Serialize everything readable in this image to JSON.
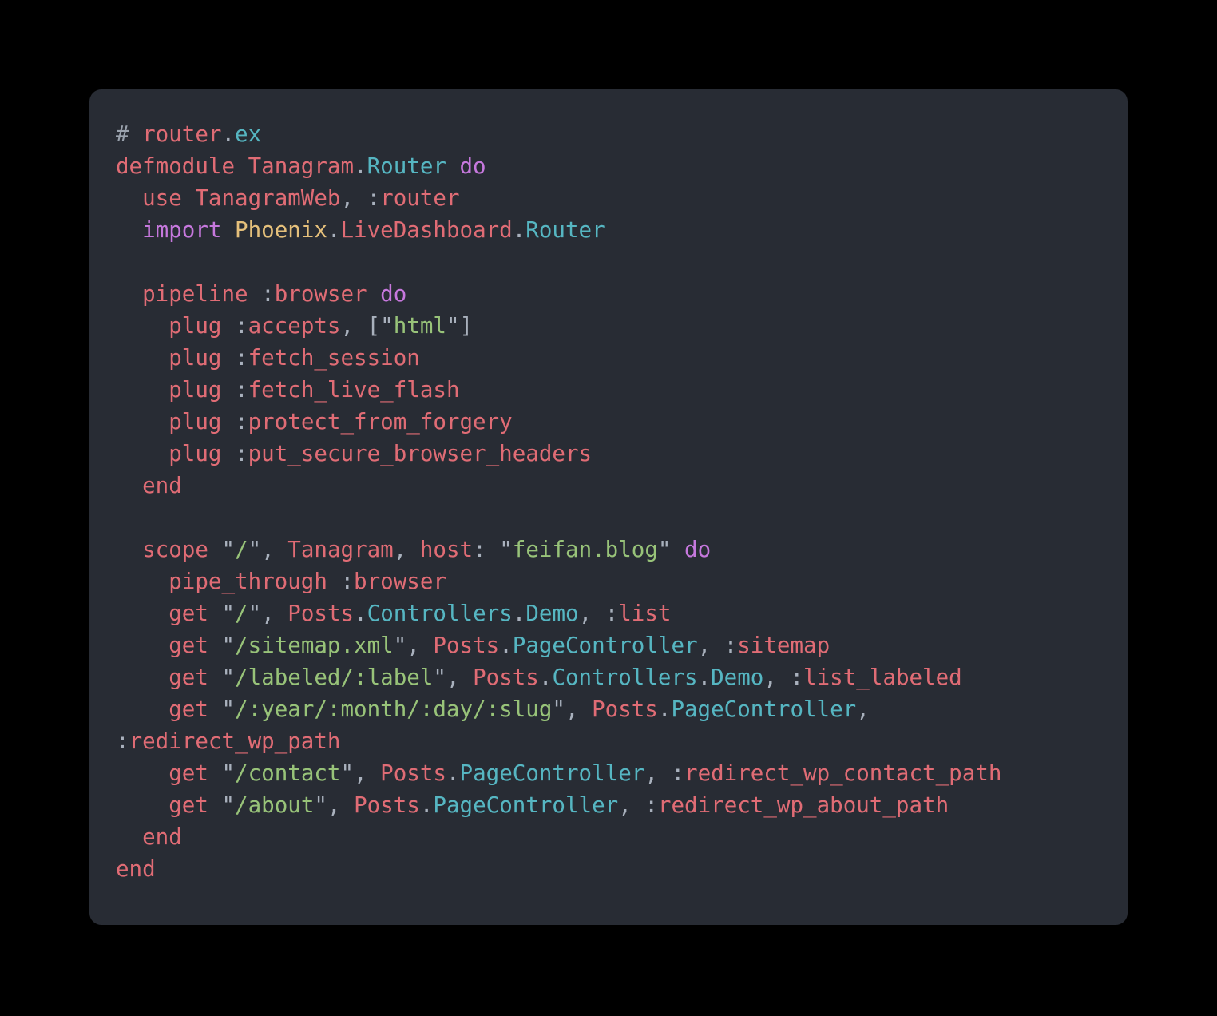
{
  "card": {
    "language": "elixir",
    "filename": "router.ex",
    "background": "#282c34",
    "page_background": "#000000"
  },
  "theme": {
    "name": "one-dark",
    "foreground": "#abb2bf",
    "punctuation": "#a9b1bd",
    "keyword": "#e06c75",
    "keyword_do": "#c678dd",
    "atom": "#e06c75",
    "module": "#56b6c2",
    "module_alt_red": "#e06c75",
    "module_alt_yellow": "#e5c07b",
    "string": "#98c379",
    "comment": "#9aa2ad"
  },
  "code": {
    "raw": "# router.ex\ndefmodule Tanagram.Router do\n  use TanagramWeb, :router\n  import Phoenix.LiveDashboard.Router\n\n  pipeline :browser do\n    plug :accepts, [\"html\"]\n    plug :fetch_session\n    plug :fetch_live_flash\n    plug :protect_from_forgery\n    plug :put_secure_browser_headers\n  end\n\n  scope \"/\", Tanagram, host: \"feifan.blog\" do\n    pipe_through :browser\n    get \"/\", Posts.Controllers.Demo, :list\n    get \"/sitemap.xml\", Posts.PageController, :sitemap\n    get \"/labeled/:label\", Posts.Controllers.Demo, :list_labeled\n    get \"/:year/:month/:day/:slug\", Posts.PageController, :redirect_wp_path\n    get \"/contact\", Posts.PageController, :redirect_wp_contact_path\n    get \"/about\", Posts.PageController, :redirect_wp_about_path\n  end\nend",
    "lines": [
      {
        "n": 1,
        "text": "# router.ex",
        "tokens": [
          {
            "t": "# ",
            "c": "com"
          },
          {
            "t": "router",
            "c": "kw"
          },
          {
            "t": ".",
            "c": "punc"
          },
          {
            "t": "ex",
            "c": "mod"
          }
        ]
      },
      {
        "n": 2,
        "text": "defmodule Tanagram.Router do",
        "tokens": [
          {
            "t": "defmodule ",
            "c": "kw"
          },
          {
            "t": "Tanagram",
            "c": "modred"
          },
          {
            "t": ".",
            "c": "punc"
          },
          {
            "t": "Router",
            "c": "mod"
          },
          {
            "t": " ",
            "c": "punc"
          },
          {
            "t": "do",
            "c": "kwdo"
          }
        ]
      },
      {
        "n": 3,
        "text": "  use TanagramWeb, :router",
        "tokens": [
          {
            "t": "  ",
            "c": "punc"
          },
          {
            "t": "use ",
            "c": "kw"
          },
          {
            "t": "TanagramWeb",
            "c": "modred"
          },
          {
            "t": ", ",
            "c": "punc"
          },
          {
            "t": ":",
            "c": "punc"
          },
          {
            "t": "router",
            "c": "atom"
          }
        ]
      },
      {
        "n": 4,
        "text": "  import Phoenix.LiveDashboard.Router",
        "tokens": [
          {
            "t": "  ",
            "c": "punc"
          },
          {
            "t": "import ",
            "c": "kwdo"
          },
          {
            "t": "Phoenix",
            "c": "modyel"
          },
          {
            "t": ".",
            "c": "punc"
          },
          {
            "t": "LiveDashboard",
            "c": "modred"
          },
          {
            "t": ".",
            "c": "punc"
          },
          {
            "t": "Router",
            "c": "mod"
          }
        ]
      },
      {
        "n": 5,
        "text": "",
        "tokens": []
      },
      {
        "n": 6,
        "text": "  pipeline :browser do",
        "tokens": [
          {
            "t": "  ",
            "c": "punc"
          },
          {
            "t": "pipeline ",
            "c": "kw"
          },
          {
            "t": ":",
            "c": "punc"
          },
          {
            "t": "browser",
            "c": "atom"
          },
          {
            "t": " ",
            "c": "punc"
          },
          {
            "t": "do",
            "c": "kwdo"
          }
        ]
      },
      {
        "n": 7,
        "text": "    plug :accepts, [\"html\"]",
        "tokens": [
          {
            "t": "    ",
            "c": "punc"
          },
          {
            "t": "plug ",
            "c": "kw"
          },
          {
            "t": ":",
            "c": "punc"
          },
          {
            "t": "accepts",
            "c": "atom"
          },
          {
            "t": ", [",
            "c": "punc"
          },
          {
            "t": "\"",
            "c": "quote"
          },
          {
            "t": "html",
            "c": "str"
          },
          {
            "t": "\"",
            "c": "quote"
          },
          {
            "t": "]",
            "c": "punc"
          }
        ]
      },
      {
        "n": 8,
        "text": "    plug :fetch_session",
        "tokens": [
          {
            "t": "    ",
            "c": "punc"
          },
          {
            "t": "plug ",
            "c": "kw"
          },
          {
            "t": ":",
            "c": "punc"
          },
          {
            "t": "fetch_session",
            "c": "atom"
          }
        ]
      },
      {
        "n": 9,
        "text": "    plug :fetch_live_flash",
        "tokens": [
          {
            "t": "    ",
            "c": "punc"
          },
          {
            "t": "plug ",
            "c": "kw"
          },
          {
            "t": ":",
            "c": "punc"
          },
          {
            "t": "fetch_live_flash",
            "c": "atom"
          }
        ]
      },
      {
        "n": 10,
        "text": "    plug :protect_from_forgery",
        "tokens": [
          {
            "t": "    ",
            "c": "punc"
          },
          {
            "t": "plug ",
            "c": "kw"
          },
          {
            "t": ":",
            "c": "punc"
          },
          {
            "t": "protect_from_forgery",
            "c": "atom"
          }
        ]
      },
      {
        "n": 11,
        "text": "    plug :put_secure_browser_headers",
        "tokens": [
          {
            "t": "    ",
            "c": "punc"
          },
          {
            "t": "plug ",
            "c": "kw"
          },
          {
            "t": ":",
            "c": "punc"
          },
          {
            "t": "put_secure_browser_headers",
            "c": "atom"
          }
        ]
      },
      {
        "n": 12,
        "text": "  end",
        "tokens": [
          {
            "t": "  ",
            "c": "punc"
          },
          {
            "t": "end",
            "c": "kw"
          }
        ]
      },
      {
        "n": 13,
        "text": "",
        "tokens": []
      },
      {
        "n": 14,
        "text": "  scope \"/\", Tanagram, host: \"feifan.blog\" do",
        "tokens": [
          {
            "t": "  ",
            "c": "punc"
          },
          {
            "t": "scope ",
            "c": "kw"
          },
          {
            "t": "\"",
            "c": "quote"
          },
          {
            "t": "/",
            "c": "str"
          },
          {
            "t": "\"",
            "c": "quote"
          },
          {
            "t": ", ",
            "c": "punc"
          },
          {
            "t": "Tanagram",
            "c": "modred"
          },
          {
            "t": ", ",
            "c": "punc"
          },
          {
            "t": "host",
            "c": "kw"
          },
          {
            "t": ": ",
            "c": "punc"
          },
          {
            "t": "\"",
            "c": "quote"
          },
          {
            "t": "feifan.blog",
            "c": "str"
          },
          {
            "t": "\"",
            "c": "quote"
          },
          {
            "t": " ",
            "c": "punc"
          },
          {
            "t": "do",
            "c": "kwdo"
          }
        ]
      },
      {
        "n": 15,
        "text": "    pipe_through :browser",
        "tokens": [
          {
            "t": "    ",
            "c": "punc"
          },
          {
            "t": "pipe_through ",
            "c": "kw"
          },
          {
            "t": ":",
            "c": "punc"
          },
          {
            "t": "browser",
            "c": "atom"
          }
        ]
      },
      {
        "n": 16,
        "text": "    get \"/\", Posts.Controllers.Demo, :list",
        "tokens": [
          {
            "t": "    ",
            "c": "punc"
          },
          {
            "t": "get ",
            "c": "kw"
          },
          {
            "t": "\"",
            "c": "quote"
          },
          {
            "t": "/",
            "c": "str"
          },
          {
            "t": "\"",
            "c": "quote"
          },
          {
            "t": ", ",
            "c": "punc"
          },
          {
            "t": "Posts",
            "c": "modred"
          },
          {
            "t": ".",
            "c": "punc"
          },
          {
            "t": "Controllers",
            "c": "mod"
          },
          {
            "t": ".",
            "c": "punc"
          },
          {
            "t": "Demo",
            "c": "mod"
          },
          {
            "t": ", ",
            "c": "punc"
          },
          {
            "t": ":",
            "c": "punc"
          },
          {
            "t": "list",
            "c": "atom"
          }
        ]
      },
      {
        "n": 17,
        "text": "    get \"/sitemap.xml\", Posts.PageController, :sitemap",
        "tokens": [
          {
            "t": "    ",
            "c": "punc"
          },
          {
            "t": "get ",
            "c": "kw"
          },
          {
            "t": "\"",
            "c": "quote"
          },
          {
            "t": "/sitemap.xml",
            "c": "str"
          },
          {
            "t": "\"",
            "c": "quote"
          },
          {
            "t": ", ",
            "c": "punc"
          },
          {
            "t": "Posts",
            "c": "modred"
          },
          {
            "t": ".",
            "c": "punc"
          },
          {
            "t": "PageController",
            "c": "mod"
          },
          {
            "t": ", ",
            "c": "punc"
          },
          {
            "t": ":",
            "c": "punc"
          },
          {
            "t": "sitemap",
            "c": "atom"
          }
        ]
      },
      {
        "n": 18,
        "text": "    get \"/labeled/:label\", Posts.Controllers.Demo, :list_labeled",
        "tokens": [
          {
            "t": "    ",
            "c": "punc"
          },
          {
            "t": "get ",
            "c": "kw"
          },
          {
            "t": "\"",
            "c": "quote"
          },
          {
            "t": "/labeled/:label",
            "c": "str"
          },
          {
            "t": "\"",
            "c": "quote"
          },
          {
            "t": ", ",
            "c": "punc"
          },
          {
            "t": "Posts",
            "c": "modred"
          },
          {
            "t": ".",
            "c": "punc"
          },
          {
            "t": "Controllers",
            "c": "mod"
          },
          {
            "t": ".",
            "c": "punc"
          },
          {
            "t": "Demo",
            "c": "mod"
          },
          {
            "t": ", ",
            "c": "punc"
          },
          {
            "t": ":",
            "c": "punc"
          },
          {
            "t": "list_labeled",
            "c": "atom"
          }
        ]
      },
      {
        "n": 19,
        "text": "    get \"/:year/:month/:day/:slug\", Posts.PageController, :redirect_wp_path",
        "wrapped": true,
        "tokens": [
          {
            "t": "    ",
            "c": "punc"
          },
          {
            "t": "get ",
            "c": "kw"
          },
          {
            "t": "\"",
            "c": "quote"
          },
          {
            "t": "/:year/:month/:day/:slug",
            "c": "str"
          },
          {
            "t": "\"",
            "c": "quote"
          },
          {
            "t": ", ",
            "c": "punc"
          },
          {
            "t": "Posts",
            "c": "modred"
          },
          {
            "t": ".",
            "c": "punc"
          },
          {
            "t": "PageController",
            "c": "mod"
          },
          {
            "t": ", ",
            "c": "punc"
          },
          {
            "t": ":",
            "c": "punc"
          },
          {
            "t": "redirect_wp_path",
            "c": "atom"
          }
        ]
      },
      {
        "n": 20,
        "text": "    get \"/contact\", Posts.PageController, :redirect_wp_contact_path",
        "tokens": [
          {
            "t": "    ",
            "c": "punc"
          },
          {
            "t": "get ",
            "c": "kw"
          },
          {
            "t": "\"",
            "c": "quote"
          },
          {
            "t": "/contact",
            "c": "str"
          },
          {
            "t": "\"",
            "c": "quote"
          },
          {
            "t": ", ",
            "c": "punc"
          },
          {
            "t": "Posts",
            "c": "modred"
          },
          {
            "t": ".",
            "c": "punc"
          },
          {
            "t": "PageController",
            "c": "mod"
          },
          {
            "t": ", ",
            "c": "punc"
          },
          {
            "t": ":",
            "c": "punc"
          },
          {
            "t": "redirect_wp_contact_path",
            "c": "atom"
          }
        ]
      },
      {
        "n": 21,
        "text": "    get \"/about\", Posts.PageController, :redirect_wp_about_path",
        "tokens": [
          {
            "t": "    ",
            "c": "punc"
          },
          {
            "t": "get ",
            "c": "kw"
          },
          {
            "t": "\"",
            "c": "quote"
          },
          {
            "t": "/about",
            "c": "str"
          },
          {
            "t": "\"",
            "c": "quote"
          },
          {
            "t": ", ",
            "c": "punc"
          },
          {
            "t": "Posts",
            "c": "modred"
          },
          {
            "t": ".",
            "c": "punc"
          },
          {
            "t": "PageController",
            "c": "mod"
          },
          {
            "t": ", ",
            "c": "punc"
          },
          {
            "t": ":",
            "c": "punc"
          },
          {
            "t": "redirect_wp_about_path",
            "c": "atom"
          }
        ]
      },
      {
        "n": 22,
        "text": "  end",
        "tokens": [
          {
            "t": "  ",
            "c": "punc"
          },
          {
            "t": "end",
            "c": "kw"
          }
        ]
      },
      {
        "n": 23,
        "text": "end",
        "tokens": [
          {
            "t": "end",
            "c": "kw"
          }
        ]
      }
    ]
  }
}
